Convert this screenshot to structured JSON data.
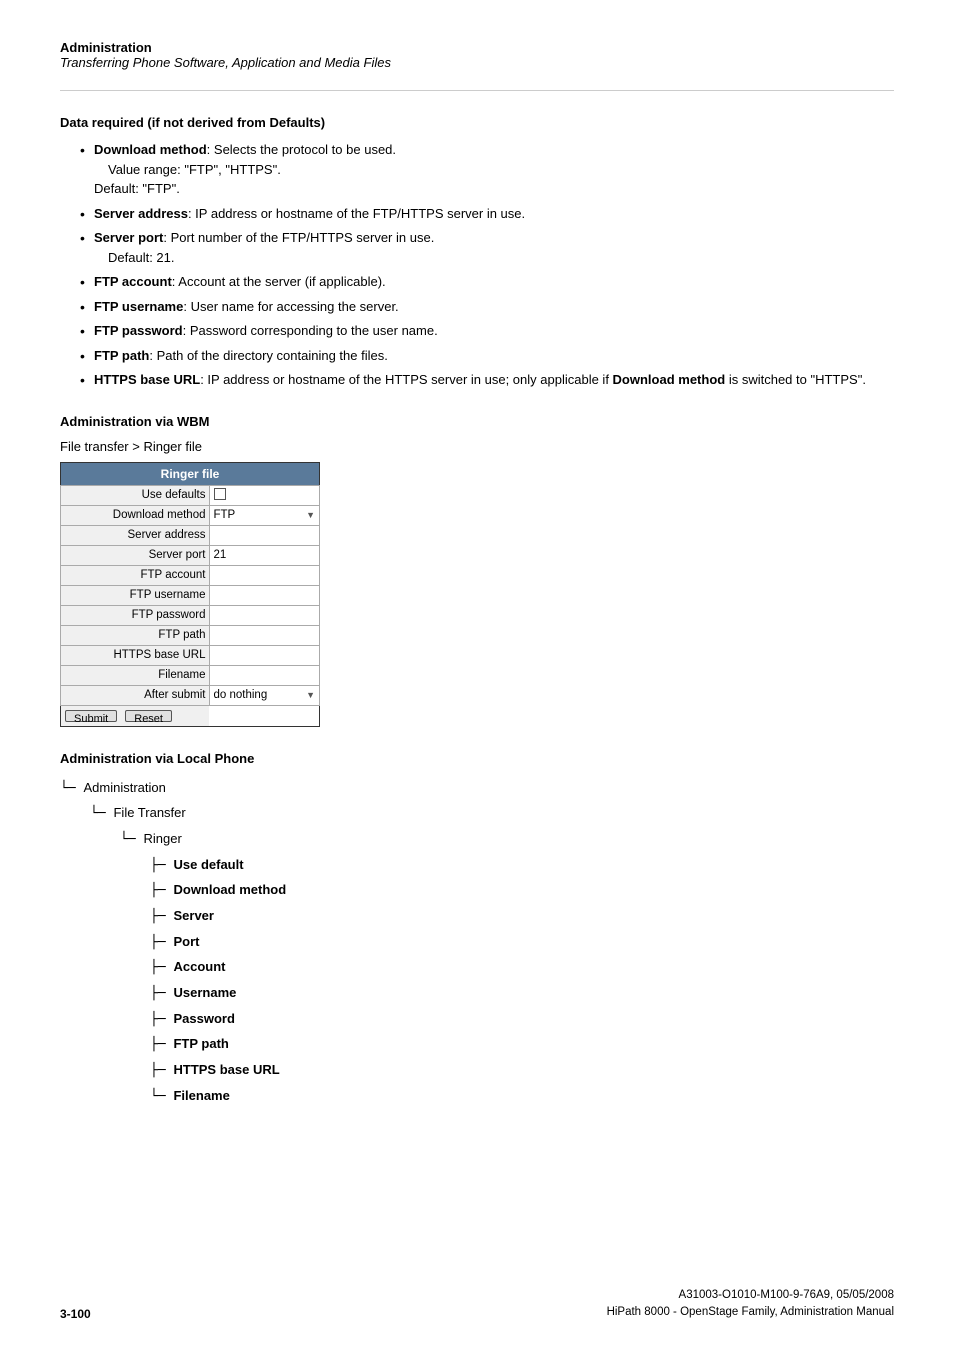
{
  "header": {
    "title": "Administration",
    "subtitle": "Transferring Phone Software, Application and Media Files"
  },
  "data_required_section": {
    "heading": "Data required (if not derived from Defaults)",
    "items": [
      {
        "term": "Download method",
        "description": "Selects the protocol to be used.",
        "extra_lines": [
          "Value range: \"FTP\", \"HTTPS\".",
          "Default: \"FTP\"."
        ]
      },
      {
        "term": "Server address",
        "description": "IP address or hostname of the FTP/HTTPS server in use.",
        "extra_lines": []
      },
      {
        "term": "Server port",
        "description": "Port number of the FTP/HTTPS server in use.",
        "extra_lines": [
          "Default: 21."
        ]
      },
      {
        "term": "FTP account",
        "description": "Account at the server (if applicable).",
        "extra_lines": []
      },
      {
        "term": "FTP username",
        "description": "User name for accessing the server.",
        "extra_lines": []
      },
      {
        "term": "FTP password",
        "description": "Password corresponding to the user name.",
        "extra_lines": []
      },
      {
        "term": "FTP path",
        "description": "Path of the directory containing the files.",
        "extra_lines": []
      },
      {
        "term": "HTTPS base URL",
        "description": "IP address or hostname of the HTTPS server in use; only applicable if",
        "extra_lines": [
          "Download method is switched to \"HTTPS\"."
        ],
        "last_term_bold": "Download method"
      }
    ]
  },
  "wbm_section": {
    "heading": "Administration via WBM",
    "path": "File transfer > Ringer file",
    "table": {
      "header": "Ringer file",
      "rows": [
        {
          "label": "Use defaults",
          "value": "",
          "type": "checkbox"
        },
        {
          "label": "Download method",
          "value": "FTP",
          "type": "dropdown"
        },
        {
          "label": "Server address",
          "value": "",
          "type": "text"
        },
        {
          "label": "Server port",
          "value": "21",
          "type": "text"
        },
        {
          "label": "FTP account",
          "value": "",
          "type": "text"
        },
        {
          "label": "FTP username",
          "value": "",
          "type": "text"
        },
        {
          "label": "FTP password",
          "value": "",
          "type": "text"
        },
        {
          "label": "FTP path",
          "value": "",
          "type": "text"
        },
        {
          "label": "HTTPS base URL",
          "value": "",
          "type": "text"
        },
        {
          "label": "Filename",
          "value": "",
          "type": "text"
        },
        {
          "label": "After submit",
          "value": "do nothing",
          "type": "dropdown"
        }
      ],
      "buttons": [
        "Submit",
        "Reset"
      ]
    }
  },
  "local_phone_section": {
    "heading": "Administration via Local Phone",
    "tree": [
      {
        "level": 0,
        "prefix": "└─",
        "label": "Administration",
        "bold": false
      },
      {
        "level": 1,
        "prefix": "└─",
        "label": "File Transfer",
        "bold": false
      },
      {
        "level": 2,
        "prefix": "└─",
        "label": "Ringer",
        "bold": false
      },
      {
        "level": 3,
        "prefix": "├─",
        "label": "Use default",
        "bold": true
      },
      {
        "level": 3,
        "prefix": "├─",
        "label": "Download method",
        "bold": true
      },
      {
        "level": 3,
        "prefix": "├─",
        "label": "Server",
        "bold": true
      },
      {
        "level": 3,
        "prefix": "├─",
        "label": "Port",
        "bold": true
      },
      {
        "level": 3,
        "prefix": "├─",
        "label": "Account",
        "bold": true
      },
      {
        "level": 3,
        "prefix": "├─",
        "label": "Username",
        "bold": true
      },
      {
        "level": 3,
        "prefix": "├─",
        "label": "Password",
        "bold": true
      },
      {
        "level": 3,
        "prefix": "├─",
        "label": "FTP path",
        "bold": true
      },
      {
        "level": 3,
        "prefix": "├─",
        "label": "HTTPS base URL",
        "bold": true
      },
      {
        "level": 3,
        "prefix": "└─",
        "label": "Filename",
        "bold": true
      }
    ]
  },
  "footer": {
    "page_number": "3-100",
    "doc_id": "A31003-O1010-M100-9-76A9, 05/05/2008",
    "doc_title": "HiPath 8000 - OpenStage Family, Administration Manual"
  }
}
